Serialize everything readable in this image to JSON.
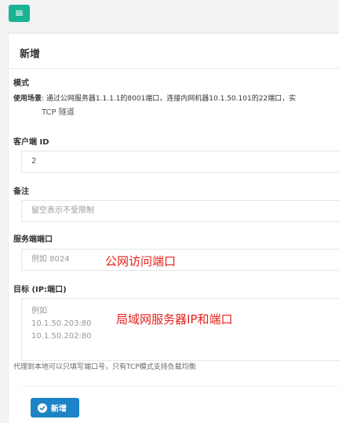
{
  "topbar": {
    "menu_icon": "hamburger-icon",
    "menu_glyph": "≡"
  },
  "card": {
    "title": "新增"
  },
  "form": {
    "mode": {
      "label": "模式",
      "help_prefix": "使用场景",
      "help_text": ": 通过公网服务器1.1.1.1的8001端口，连接内网机器10.1.50.101的22端口，实",
      "value": "TCP 隧道"
    },
    "client_id": {
      "label": "客户端 ID",
      "value": "2"
    },
    "remark": {
      "label": "备注",
      "placeholder": "留空表示不受限制"
    },
    "server_port": {
      "label": "服务端端口",
      "placeholder": "例如 8024"
    },
    "target": {
      "label": "目标 (IP:端口)",
      "placeholder_lines": [
        "例如",
        "10.1.50.203:80",
        "10.1.50.202:80"
      ],
      "help": "代理到本地可以只填写端口号，只有TCP模式支持负载均衡"
    },
    "submit_label": "新增"
  },
  "annotations": {
    "server_port_note": "公网访问端口",
    "target_note": "局域网服务器IP和端口"
  },
  "colors": {
    "menu_button": "#1ab394",
    "submit_button": "#1c84c6",
    "annotation": "#e8201c"
  }
}
